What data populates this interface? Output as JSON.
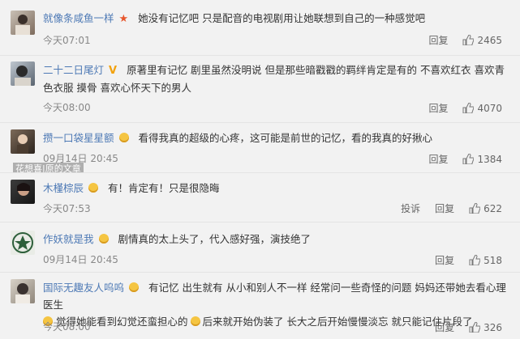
{
  "comments": [
    {
      "user": "就像条咸鱼一样",
      "text": "她没有记忆吧 只是配音的电视剧用让她联想到自己的一种感觉吧",
      "time": "今天07:01",
      "reply": "回复",
      "likes": "2465",
      "report": ""
    },
    {
      "user": "二十二日尾灯",
      "text": "原著里有记忆 剧里虽然没明说 但是那些暗戳戳的羁绊肯定是有的 不喜欢红衣 喜欢青色衣服 摸骨 喜欢心怀天下的男人",
      "time": "今天08:00",
      "reply": "回复",
      "likes": "4070",
      "report": ""
    },
    {
      "user": "攒一口袋星星额",
      "text": "看得我真的超级的心疼，这可能是前世的记忆，看的我真的好揪心",
      "time": "09月14日 20:45",
      "reply": "回复",
      "likes": "1384",
      "report": ""
    },
    {
      "user": "木槿棕辰",
      "text": "有！肯定有！只是很隐晦",
      "time": "今天07:53",
      "reply": "回复",
      "likes": "622",
      "report": "投诉"
    },
    {
      "user": "作妖就是我",
      "text": "剧情真的太上头了，代入感好强，演技绝了",
      "time": "09月14日 20:45",
      "reply": "回复",
      "likes": "518",
      "report": ""
    },
    {
      "user": "国际无趣友人呜呜",
      "text1": "有记忆 出生就有 从小和别人不一样 经常问一些奇怪的问题 妈妈还带她去看心理医生",
      "text2": "觉得她能看到幻觉还蛮担心的",
      "text3": "后来就开始伪装了 长大之后开始慢慢淡忘 就只能记住片段了",
      "time": "今天08:00",
      "reply": "回复",
      "likes": "326",
      "report": ""
    }
  ],
  "watermark": "花想喜|原的文章",
  "colors": {
    "username": "#4d79b5",
    "background": "#f2f2f2"
  }
}
